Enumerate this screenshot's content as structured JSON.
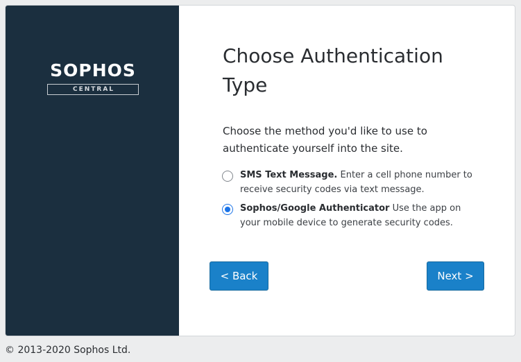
{
  "brand": {
    "logo_word": "SOPHOS",
    "logo_sub": "CENTRAL"
  },
  "page": {
    "title": "Choose Authentication Type",
    "intro": "Choose the method you'd like to use to authenticate yourself into the site."
  },
  "options": [
    {
      "label": "SMS Text Message.",
      "description": "Enter a cell phone number to receive security codes via text message.",
      "selected": false
    },
    {
      "label": "Sophos/Google Authenticator",
      "description": "Use the app on your mobile device to generate security codes.",
      "selected": true
    }
  ],
  "buttons": {
    "back": "< Back",
    "next": "Next >"
  },
  "footer": {
    "copyright": "© 2013-2020 Sophos Ltd."
  },
  "colors": {
    "sidebar": "#1b2f3f",
    "button": "#1a81c9",
    "radio_selected": "#1a73e8"
  }
}
